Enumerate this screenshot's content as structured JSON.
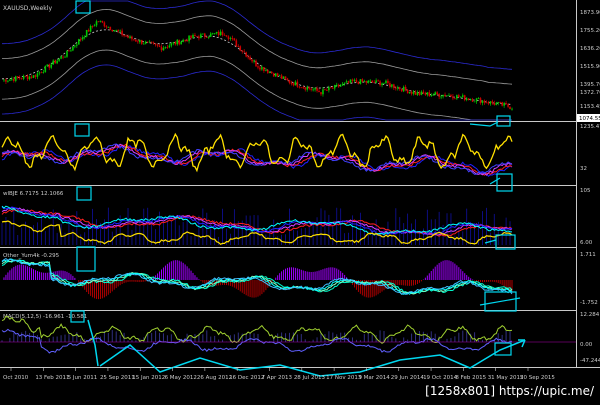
{
  "window": {
    "symbol_title": "XAUUSD,Weekly",
    "watermark": "[1258x801] https://upic.me/"
  },
  "colors": {
    "background": "#000000",
    "grid_separator": "#c8c8c8",
    "bull_candle": "#00c800",
    "bear_candle": "#d00000",
    "annotation": "#00d8f0",
    "price_box": "#ffffff",
    "yellow_line": "#ffe000",
    "blue_line": "#2020ff",
    "red_line": "#ff2020",
    "magenta_line": "#d040ff",
    "teal_line": "#00ffd0",
    "cyan_line": "#00ffff",
    "purple_hist": "#a000ff",
    "dark_red_hist": "#b00000",
    "navy_line": "#1010a0"
  },
  "panels": [
    {
      "id": "price",
      "label": "XAUUSD,Weekly",
      "price_labels": [
        "1873.90",
        "1755.20",
        "1636.20",
        "1515.90",
        "1395.70",
        "1372.70",
        "1153.45"
      ],
      "current_price": "1074.55"
    },
    {
      "id": "oscillator-1",
      "label": "",
      "price_labels": [
        "1235.47",
        "32"
      ]
    },
    {
      "id": "oscillator-2",
      "label": "wlBJE 6.7175 12.1066",
      "price_labels": [
        "105",
        "6.00"
      ]
    },
    {
      "id": "oscillator-3",
      "label": "Other_Yum4k -0.295",
      "price_labels": [
        "1.711",
        "-1.752"
      ]
    },
    {
      "id": "macd",
      "label": "MACD(5,12,5) -16.961 -10.581",
      "price_labels": [
        "12.284",
        "0.00",
        "-47.244"
      ]
    }
  ],
  "time_axis": [
    "Oct 2010",
    "13 Feb 2011",
    "5 Jun 2011",
    "25 Sep 2011",
    "15 Jan 2012",
    "6 May 2012",
    "26 Aug 2012",
    "16 Dec 2012",
    "7 Apr 2013",
    "28 Jul 2013",
    "17 Nov 2013",
    "9 Mar 2014",
    "29 Jun 2014",
    "19 Oct 2014",
    "8 Feb 2015",
    "31 May 2015",
    "20 Sep 2015"
  ],
  "chart_data": {
    "type": "line",
    "title": "XAUUSD,Weekly",
    "xlabel": "",
    "ylabel": "",
    "x": [
      "Oct 2010",
      "13 Feb 2011",
      "5 Jun 2011",
      "25 Sep 2011",
      "15 Jan 2012",
      "6 May 2012",
      "26 Aug 2012",
      "16 Dec 2012",
      "7 Apr 2013",
      "28 Jul 2013",
      "17 Nov 2013",
      "9 Mar 2014",
      "29 Jun 2014",
      "19 Oct 2014",
      "8 Feb 2015",
      "31 May 2015",
      "20 Sep 2015"
    ],
    "series": [
      {
        "values": [
          1340,
          1370,
          1530,
          1780,
          1650,
          1580,
          1660,
          1690,
          1450,
          1330,
          1250,
          1330,
          1320,
          1240,
          1230,
          1190,
          1140
        ]
      }
    ],
    "ylim": [
      1074.55,
      1873.9
    ],
    "grid": false
  }
}
